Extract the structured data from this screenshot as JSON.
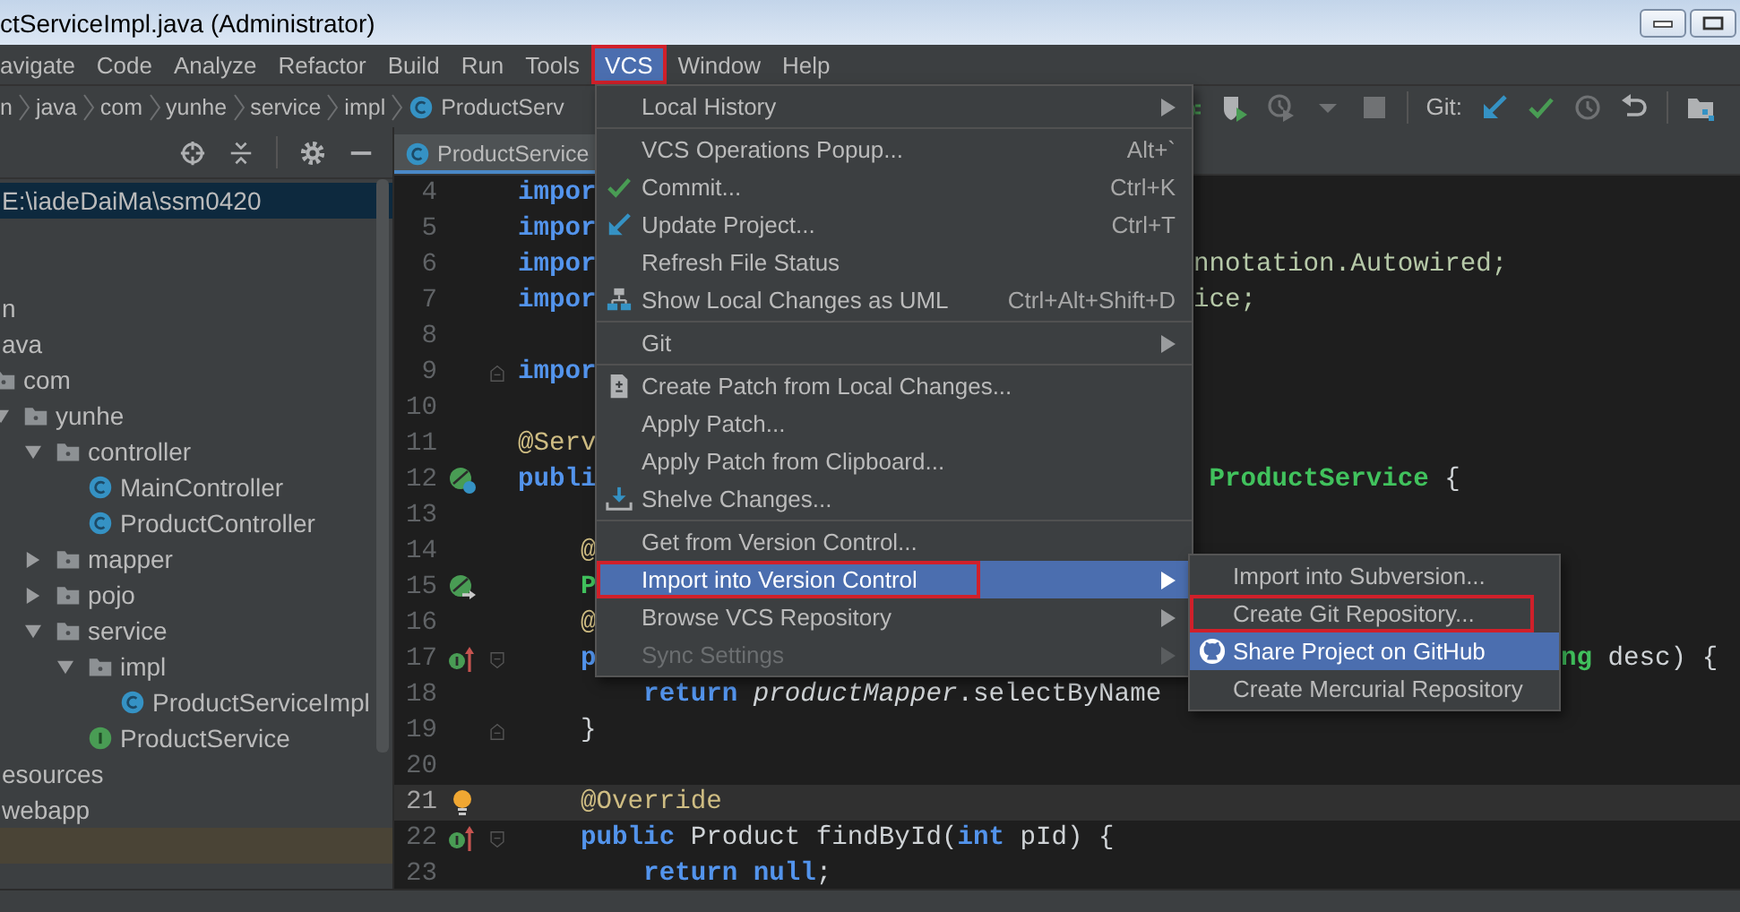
{
  "window": {
    "title": "ctServiceImpl.java (Administrator)"
  },
  "menu_bar": [
    {
      "label": "avigate",
      "selected": false,
      "highlighted": false
    },
    {
      "label": "Code",
      "selected": false,
      "highlighted": false
    },
    {
      "label": "Analyze",
      "selected": false,
      "highlighted": false
    },
    {
      "label": "Refactor",
      "selected": false,
      "highlighted": false
    },
    {
      "label": "Build",
      "selected": false,
      "highlighted": false
    },
    {
      "label": "Run",
      "selected": false,
      "highlighted": false
    },
    {
      "label": "Tools",
      "selected": false,
      "highlighted": false
    },
    {
      "label": "VCS",
      "selected": true,
      "highlighted": true
    },
    {
      "label": "Window",
      "selected": false,
      "highlighted": false
    },
    {
      "label": "Help",
      "selected": false,
      "highlighted": false
    }
  ],
  "breadcrumbs": [
    {
      "label": "n",
      "kind": "folder"
    },
    {
      "label": "java",
      "kind": "folder"
    },
    {
      "label": "com",
      "kind": "folder"
    },
    {
      "label": "yunhe",
      "kind": "folder"
    },
    {
      "label": "service",
      "kind": "folder"
    },
    {
      "label": "impl",
      "kind": "folder"
    },
    {
      "label": "ProductServ",
      "kind": "class"
    }
  ],
  "toolbar": [
    {
      "kind": "debug",
      "disabled": false
    },
    {
      "kind": "coverage",
      "disabled": false
    },
    {
      "kind": "profile",
      "disabled": true
    },
    {
      "kind": "dropdown",
      "disabled": true
    },
    {
      "kind": "stop",
      "disabled": true
    },
    {
      "kind": "separator"
    },
    {
      "kind": "label",
      "text": "Git:"
    },
    {
      "kind": "update",
      "disabled": false
    },
    {
      "kind": "commit",
      "disabled": false
    },
    {
      "kind": "history",
      "disabled": true
    },
    {
      "kind": "rollback",
      "disabled": false
    },
    {
      "kind": "separator"
    },
    {
      "kind": "structure",
      "disabled": false
    }
  ],
  "project_panel": {
    "tools": [
      {
        "kind": "locate"
      },
      {
        "kind": "collapse"
      },
      {
        "kind": "separator"
      },
      {
        "kind": "settings"
      },
      {
        "kind": "hide"
      }
    ],
    "tree": [
      {
        "label": "E:\\iadeDaiMa\\ssm0420",
        "kind": "label",
        "selected": true
      },
      {
        "label": "n",
        "kind": "label",
        "selected": false
      },
      {
        "label": "ava",
        "kind": "label",
        "selected": false
      },
      {
        "label": "com",
        "kind": "folder",
        "selected": false,
        "children": [
          {
            "label": "yunhe",
            "kind": "folder",
            "expanded": true,
            "selected": false,
            "children": [
              {
                "label": "controller",
                "kind": "folder",
                "expanded": true,
                "selected": false,
                "children": [
                  {
                    "label": "MainController",
                    "kind": "class",
                    "selected": false
                  },
                  {
                    "label": "ProductController",
                    "kind": "class",
                    "selected": false
                  }
                ]
              },
              {
                "label": "mapper",
                "kind": "folder",
                "expanded": false,
                "selected": false
              },
              {
                "label": "pojo",
                "kind": "folder",
                "expanded": false,
                "selected": false
              },
              {
                "label": "service",
                "kind": "folder",
                "expanded": true,
                "selected": false,
                "children": [
                  {
                    "label": "impl",
                    "kind": "folder",
                    "expanded": true,
                    "selected": false,
                    "children": [
                      {
                        "label": "ProductServiceImpl",
                        "kind": "class",
                        "selected": false
                      }
                    ]
                  },
                  {
                    "label": "ProductService",
                    "kind": "interface",
                    "selected": false
                  }
                ]
              }
            ]
          }
        ]
      },
      {
        "label": "esources",
        "kind": "label",
        "selected": false
      },
      {
        "label": "webapp",
        "kind": "label",
        "selected": false
      }
    ]
  },
  "editor": {
    "tabs": [
      {
        "label": "ProductService",
        "selected": true
      }
    ],
    "lines": [
      {
        "number": "4",
        "current": false,
        "code": [
          {
            "text": "impor",
            "kind": "keyword"
          }
        ]
      },
      {
        "number": "5",
        "current": false,
        "code": [
          {
            "text": "impor",
            "kind": "keyword"
          }
        ]
      },
      {
        "number": "6",
        "current": false,
        "code": [
          {
            "text": "impor",
            "kind": "keyword"
          }
        ],
        "past_menu": [
          {
            "text": "nnotation.Autowired;",
            "kind": "package"
          }
        ]
      },
      {
        "number": "7",
        "current": false,
        "code": [
          {
            "text": "impor",
            "kind": "keyword"
          }
        ],
        "past_menu": [
          {
            "text": "ice;",
            "kind": "package"
          }
        ]
      },
      {
        "number": "8",
        "current": false
      },
      {
        "number": "9",
        "current": false,
        "fold": [
          {
            "kind": "end"
          }
        ],
        "code": [
          {
            "text": "impor",
            "kind": "keyword"
          }
        ]
      },
      {
        "number": "10",
        "current": false
      },
      {
        "number": "11",
        "current": false,
        "code": [
          {
            "text": "@Serv",
            "kind": "annotation"
          }
        ]
      },
      {
        "number": "12",
        "current": false,
        "gutter": [
          {
            "kind": "bean"
          }
        ],
        "code": [
          {
            "text": "publi",
            "kind": "keyword"
          }
        ],
        "past_menu": [
          {
            "text": " ProductService",
            "kind": "type"
          },
          {
            "text": " {",
            "kind": "plain"
          }
        ]
      },
      {
        "number": "13",
        "current": false
      },
      {
        "number": "14",
        "current": false,
        "code": [
          {
            "text": "    @",
            "kind": "annotation"
          }
        ]
      },
      {
        "number": "15",
        "current": false,
        "gutter": [
          {
            "kind": "autowired"
          }
        ],
        "code": [
          {
            "text": "    P",
            "kind": "type"
          }
        ]
      },
      {
        "number": "16",
        "current": false,
        "code": [
          {
            "text": "    @",
            "kind": "annotation"
          }
        ]
      },
      {
        "number": "17",
        "current": false,
        "gutter": [
          {
            "kind": "implements"
          }
        ],
        "fold": [
          {
            "kind": "start"
          }
        ],
        "code": [
          {
            "text": "    p",
            "kind": "keyword"
          }
        ],
        "past_submenu": [
          {
            "text": "ng",
            "kind": "type"
          },
          {
            "text": " desc) {",
            "kind": "plain"
          }
        ]
      },
      {
        "number": "18",
        "current": false,
        "code": [
          {
            "text": "        return ",
            "kind": "keyword"
          },
          {
            "text": "productMapper",
            "kind": "field"
          },
          {
            "text": ".selectByName",
            "kind": "plain"
          }
        ]
      },
      {
        "number": "19",
        "current": false,
        "fold": [
          {
            "kind": "end"
          }
        ],
        "code": [
          {
            "text": "    }",
            "kind": "plain"
          }
        ]
      },
      {
        "number": "20",
        "current": false
      },
      {
        "number": "21",
        "current": true,
        "gutter": [
          {
            "kind": "bulb"
          }
        ],
        "code": [
          {
            "text": "    @Override",
            "kind": "annotation"
          }
        ]
      },
      {
        "number": "22",
        "current": false,
        "gutter": [
          {
            "kind": "implements"
          }
        ],
        "fold": [
          {
            "kind": "start"
          }
        ],
        "code": [
          {
            "text": "    public",
            "kind": "keyword"
          },
          {
            "text": " Product findById(",
            "kind": "plain"
          },
          {
            "text": "int",
            "kind": "keyword"
          },
          {
            "text": " pId) {",
            "kind": "plain"
          }
        ]
      },
      {
        "number": "23",
        "current": false,
        "code": [
          {
            "text": "        return",
            "kind": "keyword"
          },
          {
            "text": " null",
            "kind": "keyword"
          },
          {
            "text": ";",
            "kind": "plain"
          }
        ]
      }
    ]
  },
  "vcs_menu": {
    "items": [
      {
        "kind": "item",
        "label": "Local History",
        "submenu": true,
        "selected": false,
        "disabled": false,
        "highlighted": false
      },
      {
        "kind": "separator"
      },
      {
        "kind": "item",
        "label": "VCS Operations Popup...",
        "shortcut": "Alt+`",
        "submenu": false,
        "selected": false,
        "disabled": false,
        "highlighted": false
      },
      {
        "kind": "commit",
        "label": "Commit...",
        "shortcut": "Ctrl+K",
        "submenu": false,
        "selected": false,
        "disabled": false,
        "highlighted": false
      },
      {
        "kind": "update",
        "label": "Update Project...",
        "shortcut": "Ctrl+T",
        "submenu": false,
        "selected": false,
        "disabled": false,
        "highlighted": false
      },
      {
        "kind": "item",
        "label": "Refresh File Status",
        "submenu": false,
        "selected": false,
        "disabled": false,
        "highlighted": false
      },
      {
        "kind": "uml",
        "label": "Show Local Changes as UML",
        "shortcut": "Ctrl+Alt+Shift+D",
        "submenu": false,
        "selected": false,
        "disabled": false,
        "highlighted": false
      },
      {
        "kind": "separator"
      },
      {
        "kind": "item",
        "label": "Git",
        "submenu": true,
        "selected": false,
        "disabled": false,
        "highlighted": false
      },
      {
        "kind": "separator"
      },
      {
        "kind": "patch",
        "label": "Create Patch from Local Changes...",
        "submenu": false,
        "selected": false,
        "disabled": false,
        "highlighted": false
      },
      {
        "kind": "item",
        "label": "Apply Patch...",
        "submenu": false,
        "selected": false,
        "disabled": false,
        "highlighted": false
      },
      {
        "kind": "item",
        "label": "Apply Patch from Clipboard...",
        "submenu": false,
        "selected": false,
        "disabled": false,
        "highlighted": false
      },
      {
        "kind": "shelve",
        "label": "Shelve Changes...",
        "submenu": false,
        "selected": false,
        "disabled": false,
        "highlighted": false
      },
      {
        "kind": "separator"
      },
      {
        "kind": "item",
        "label": "Get from Version Control...",
        "submenu": false,
        "selected": false,
        "disabled": false,
        "highlighted": false
      },
      {
        "kind": "item",
        "label": "Import into Version Control",
        "submenu": true,
        "selected": true,
        "disabled": false,
        "highlighted": true
      },
      {
        "kind": "item",
        "label": "Browse VCS Repository",
        "submenu": true,
        "selected": false,
        "disabled": false,
        "highlighted": false
      },
      {
        "kind": "item",
        "label": "Sync Settings",
        "submenu": true,
        "selected": false,
        "disabled": true,
        "highlighted": false
      }
    ]
  },
  "submenu": {
    "items": [
      {
        "kind": "item",
        "label": "Import into Subversion...",
        "submenu": false,
        "selected": false,
        "disabled": false,
        "highlighted": false
      },
      {
        "kind": "item",
        "label": "Create Git Repository...",
        "submenu": false,
        "selected": false,
        "disabled": false,
        "highlighted": true
      },
      {
        "kind": "github",
        "label": "Share Project on GitHub",
        "submenu": false,
        "selected": true,
        "disabled": false,
        "highlighted": false
      },
      {
        "kind": "item",
        "label": "Create Mercurial Repository",
        "submenu": false,
        "selected": false,
        "disabled": false,
        "highlighted": false
      }
    ]
  }
}
